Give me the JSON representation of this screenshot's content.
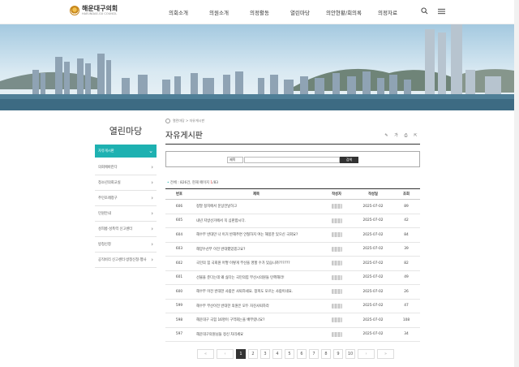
{
  "header": {
    "logo_text": "해운대구의회",
    "logo_sub": "HAEUNDAE-GU COUNCIL",
    "nav": [
      "의회소개",
      "의원소개",
      "의정활동",
      "열린마당",
      "의안현황/회의록",
      "의정자료"
    ]
  },
  "sidebar": {
    "title": "열린마당",
    "items": [
      {
        "label": "자유게시판"
      },
      {
        "label": "의회에바란다"
      },
      {
        "label": "청소년의회교실"
      },
      {
        "label": "주민조례청구"
      },
      {
        "label": "민원안내"
      },
      {
        "label": "성희롱·성폭력 신고센터"
      },
      {
        "label": "방청신청"
      },
      {
        "label": "공직비리 신고센터·방청신청·행사"
      }
    ]
  },
  "breadcrumb": "열린마당 > 자유게시판",
  "page_title": "자유게시판",
  "tools": [
    "share-icon",
    "font-size-icon",
    "print-icon",
    "export-icon"
  ],
  "search": {
    "select_value": "제목",
    "button_label": "검색"
  },
  "stat": {
    "prefix": "전체 : 826건, 현재 페이지 ",
    "current": "1",
    "suffix": "/83"
  },
  "table": {
    "headers": [
      "번호",
      "제목",
      "작성자",
      "작성일",
      "조회"
    ],
    "rows": [
      {
        "no": "606",
        "title": "정말 정치에서 문상전날하고",
        "date": "2025-07-02",
        "views": "89"
      },
      {
        "no": "605",
        "title": "내년 지방선거에서 꼭 심판합시다.",
        "date": "2025-07-02",
        "views": "42"
      },
      {
        "no": "604",
        "title": "해수부 반대만 나 이거 반해주면 안철하지 여는 해몽한 있으신 국회요?",
        "date": "2025-07-02",
        "views": "84"
      },
      {
        "no": "603",
        "title": "해양수산부 이전 반대했었겠고요?",
        "date": "2025-07-02",
        "views": "39"
      },
      {
        "no": "602",
        "title": "국민의 힘 국회원 어떻 이렇게 부산을 명할 수가 있습니까??????",
        "date": "2025-07-02",
        "views": "82"
      },
      {
        "no": "601",
        "title": "선물을 준다는데 왜 싫다는 국민의힘 부산시의원들 탄핵해라!",
        "date": "2025-07-02",
        "views": "49"
      },
      {
        "no": "600",
        "title": "해수부 이전 반대한 사람은 사퇴하세요. 창피도 모르는 사람이네요.",
        "date": "2025-07-02",
        "views": "26"
      },
      {
        "no": "599",
        "title": "해수부 부산이전 반대한 의원은 모두 자진사퇴하라",
        "date": "2025-07-02",
        "views": "47"
      },
      {
        "no": "598",
        "title": "해운대구 국힘 16명이 구역회는을 배부렀나요?",
        "date": "2025-07-02",
        "views": "108"
      },
      {
        "no": "597",
        "title": "해운대구의원님들 정신 차리세요",
        "date": "2025-07-02",
        "views": "34"
      }
    ]
  },
  "pager": {
    "first": "«",
    "prev": "‹",
    "pages": [
      "1",
      "2",
      "3",
      "4",
      "5",
      "6",
      "7",
      "8",
      "9",
      "10"
    ],
    "next": "›",
    "last": "»",
    "current": "1"
  },
  "colors": {
    "accent": "#1eb1b1",
    "dark": "#333333"
  }
}
